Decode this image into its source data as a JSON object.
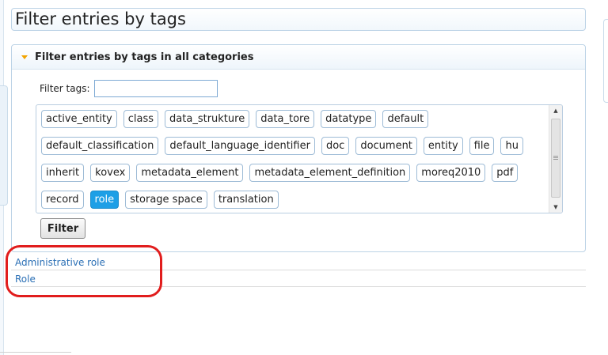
{
  "page": {
    "title": "Filter entries by tags"
  },
  "panel": {
    "header": "Filter entries by tags in all categories",
    "filter_label": "Filter tags:",
    "filter_input_value": "",
    "button_label": "Filter"
  },
  "tags": [
    [
      "active_entity",
      "class",
      "data_strukture",
      "data_tore",
      "datatype",
      "default"
    ],
    [
      "default_classification",
      "default_language_identifier",
      "doc",
      "document",
      "entity",
      "file",
      "hu"
    ],
    [
      "inherit",
      "kovex",
      "metadata_element",
      "metadata_element_definition",
      "moreq2010",
      "pdf"
    ],
    [
      "record",
      "role",
      "storage space",
      "translation"
    ]
  ],
  "selected_tag": "role",
  "results": [
    {
      "label": "Administrative role"
    },
    {
      "label": "Role"
    }
  ],
  "colors": {
    "accent": "#1e9fe6",
    "link": "#2a6fb5",
    "annotation": "#e11d1d",
    "caret": "#f2a400"
  },
  "scroll": {
    "position": 0.0
  },
  "annotation": {
    "shape": "rounded-rectangle",
    "target": "results"
  }
}
